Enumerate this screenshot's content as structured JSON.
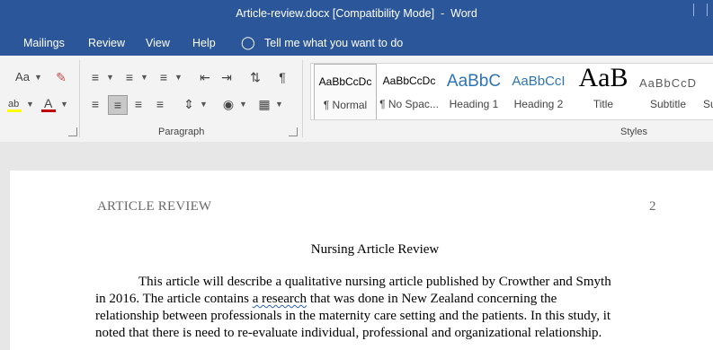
{
  "window": {
    "title": "Article-review.docx [Compatibility Mode]  -  Word"
  },
  "tabs": [
    "Mailings",
    "Review",
    "View",
    "Help"
  ],
  "tell_me": "Tell me what you want to do",
  "ribbon": {
    "font_partial": {
      "change_case": "Aa"
    },
    "groups": {
      "paragraph": "Paragraph",
      "styles": "Styles"
    },
    "styles": [
      {
        "preview": "AaBbCcDc",
        "name": "¶ Normal"
      },
      {
        "preview": "AaBbCcDc",
        "name": "¶ No Spac..."
      },
      {
        "preview": "AaBbC",
        "name": "Heading 1"
      },
      {
        "preview": "AaBbCcI",
        "name": "Heading 2"
      },
      {
        "preview": "AaB",
        "name": "Title"
      },
      {
        "preview": "AaBbCcD",
        "name": "Subtitle"
      },
      {
        "preview": "",
        "name": "Su"
      }
    ]
  },
  "document": {
    "header": "ARTICLE REVIEW",
    "page_number": "2",
    "title": "Nursing Article Review",
    "lines": [
      {
        "before": "This article will describe a qualitative nursing article published by Crowther and Smyth",
        "flagged": "",
        "after": ""
      },
      {
        "before": "in 2016. The article contains ",
        "flagged": "a research",
        "after": " that was done in New Zealand concerning the"
      },
      {
        "before": "relationship between professionals in the maternity care setting and the patients. In this study, it",
        "flagged": "",
        "after": ""
      },
      {
        "before": "noted that there is need to re-evaluate individual, professional and organizational relationship.",
        "flagged": "",
        "after": ""
      }
    ]
  }
}
